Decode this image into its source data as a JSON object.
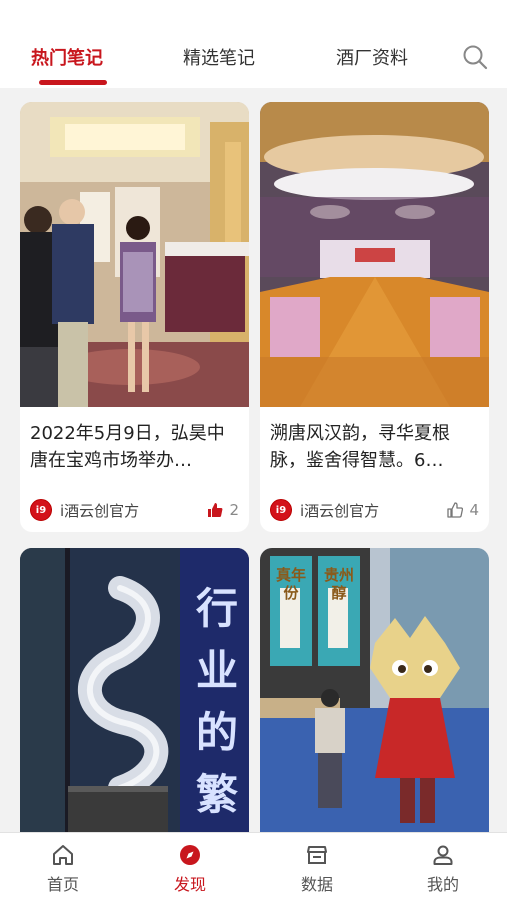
{
  "tabs": [
    {
      "label": "热门笔记",
      "active": true
    },
    {
      "label": "精选笔记",
      "active": false
    },
    {
      "label": "酒厂资料",
      "active": false
    }
  ],
  "search_icon": "search-icon",
  "accent_color": "#c8161d",
  "cards": [
    {
      "title": "2022年5月9日，弘昊中唐在宝鸡市场举办…",
      "author": "i酒云创官方",
      "avatar_text": "i9",
      "likes": "2",
      "liked": true
    },
    {
      "title": "溯唐风汉韵，寻华夏根脉，鉴舍得智慧。6…",
      "author": "i酒云创官方",
      "avatar_text": "i9",
      "likes": "4",
      "liked": false
    },
    {
      "image_text": [
        "行",
        "业",
        "的",
        "繁"
      ]
    },
    {
      "image_text": [
        "真年份",
        "贵州醇"
      ]
    }
  ],
  "nav": [
    {
      "label": "首页",
      "icon": "home-icon",
      "active": false
    },
    {
      "label": "发现",
      "icon": "compass-icon",
      "active": true
    },
    {
      "label": "数据",
      "icon": "store-icon",
      "active": false
    },
    {
      "label": "我的",
      "icon": "user-icon",
      "active": false
    }
  ]
}
